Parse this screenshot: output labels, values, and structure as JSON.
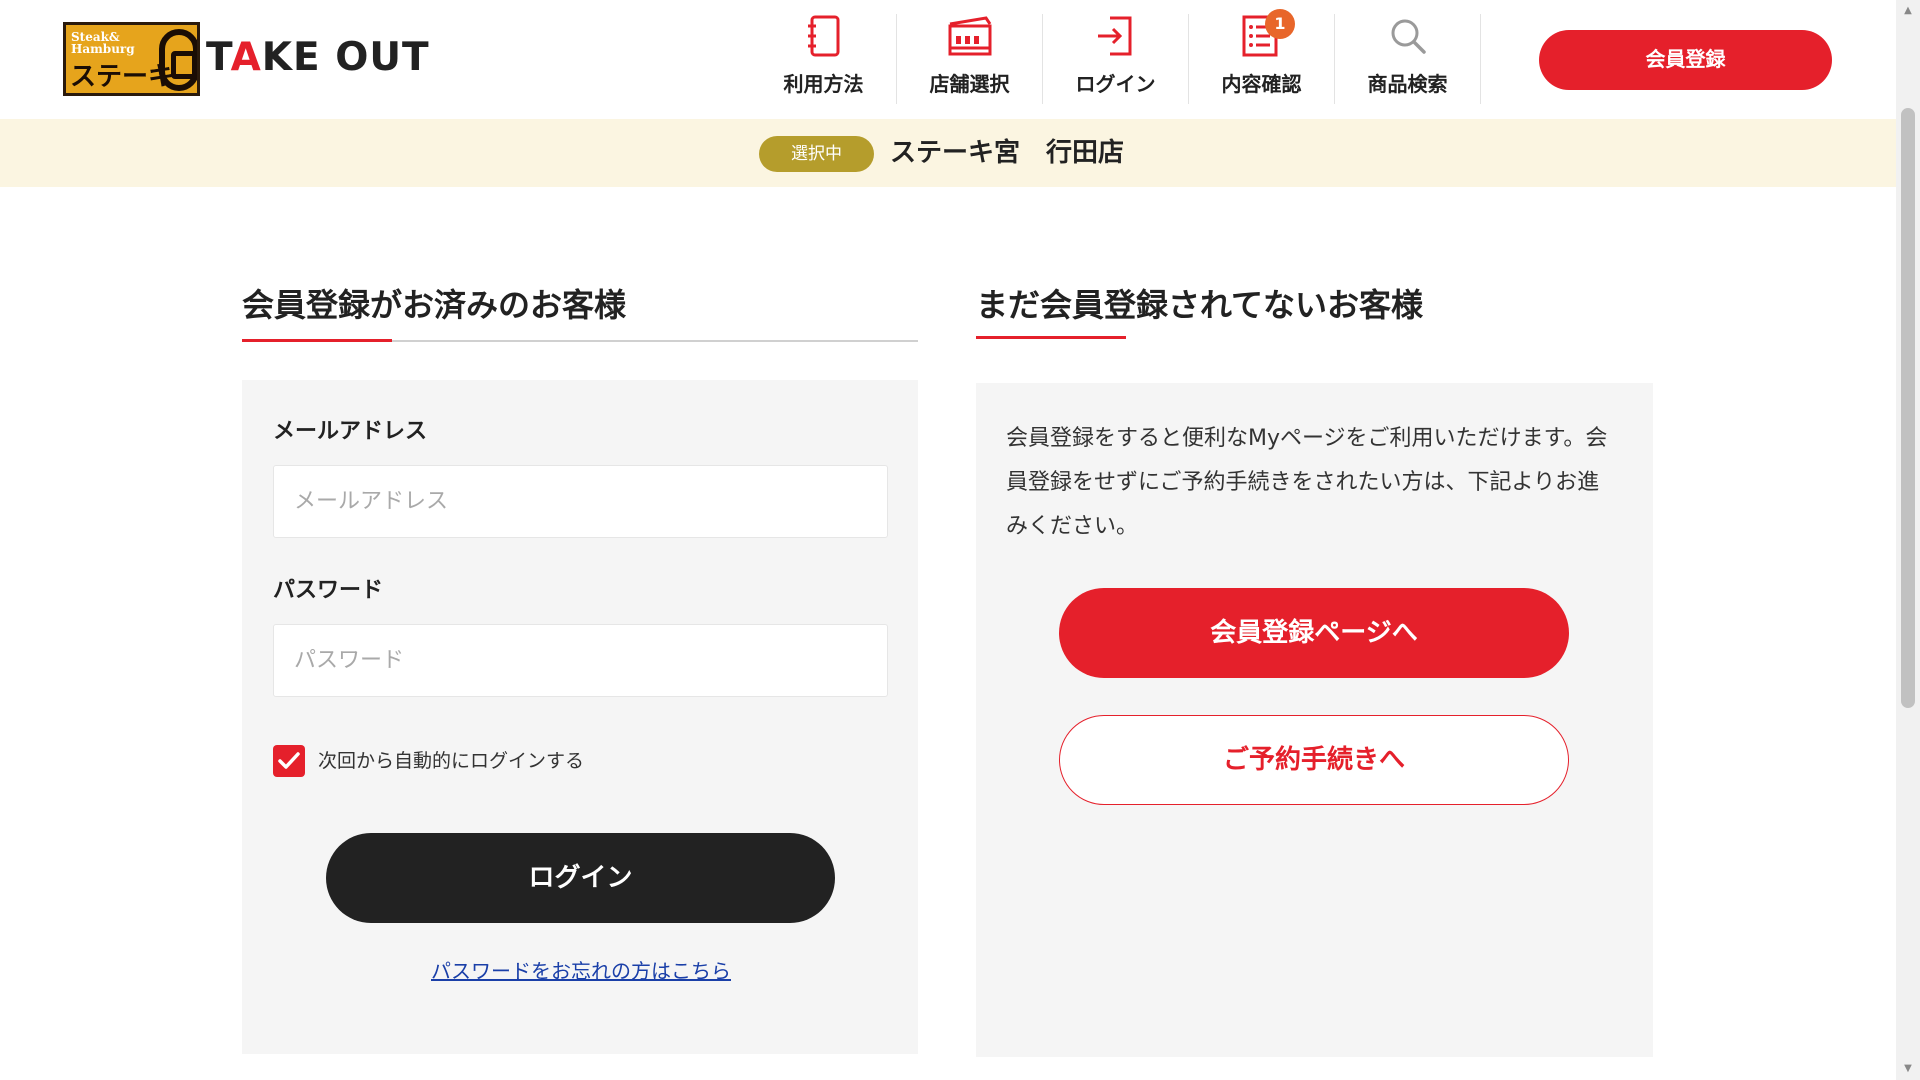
{
  "header": {
    "logo": {
      "small_text": "Steak&\nHamburg",
      "katakana": "ステーキ",
      "takeout_pre": "T",
      "takeout_a": "A",
      "takeout_post": "KE OUT"
    },
    "nav": [
      {
        "label": "利用方法",
        "icon": "guide-book-icon"
      },
      {
        "label": "店舗選択",
        "icon": "store-icon"
      },
      {
        "label": "ログイン",
        "icon": "login-icon"
      },
      {
        "label": "内容確認",
        "icon": "order-list-icon"
      },
      {
        "label": "商品検索",
        "icon": "search-icon"
      }
    ],
    "cart_count": "1",
    "register_button": "会員登録"
  },
  "store": {
    "status_pill": "選択中",
    "name": "ステーキ宮　行田店"
  },
  "login": {
    "title": "会員登録がお済みのお客様",
    "email_label": "メールアドレス",
    "email_placeholder": "メールアドレス",
    "password_label": "パスワード",
    "password_placeholder": "パスワード",
    "auto_login_label": "次回から自動的にログインする",
    "auto_login_checked": true,
    "login_button": "ログイン",
    "forgot_link": "パスワードをお忘れの方はこちら"
  },
  "guest": {
    "title": "まだ会員登録されてないお客様",
    "description": "会員登録をすると便利なMyページをご利用いただけます。会員登録をせずにご予約手続きをされたい方は、下記よりお進みください。",
    "register_page_button": "会員登録ページへ",
    "reserve_button": "ご予約手続きへ"
  },
  "colors": {
    "brand_red": "#e5202b",
    "dark": "#222222",
    "store_bar_bg": "#fbf5e1",
    "pill_gold": "#b59d2c",
    "badge_orange": "#e8662a",
    "panel_bg": "#f5f5f5",
    "link_blue": "#1a3fa8"
  }
}
